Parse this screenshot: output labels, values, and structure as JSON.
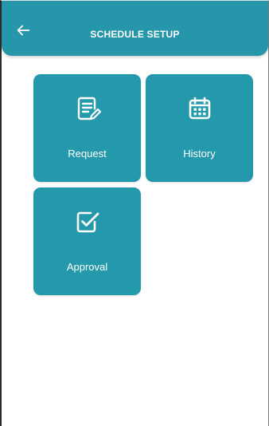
{
  "header": {
    "title": "SCHEDULE SETUP",
    "back_icon": "arrow-left-icon"
  },
  "tiles": [
    {
      "label": "Request",
      "icon": "document-edit-icon"
    },
    {
      "label": "History",
      "icon": "calendar-icon"
    },
    {
      "label": "Approval",
      "icon": "checkbox-icon"
    }
  ],
  "colors": {
    "primary": "#2697aa",
    "tile": "#2499ac",
    "text_on_primary": "#ffffff"
  }
}
